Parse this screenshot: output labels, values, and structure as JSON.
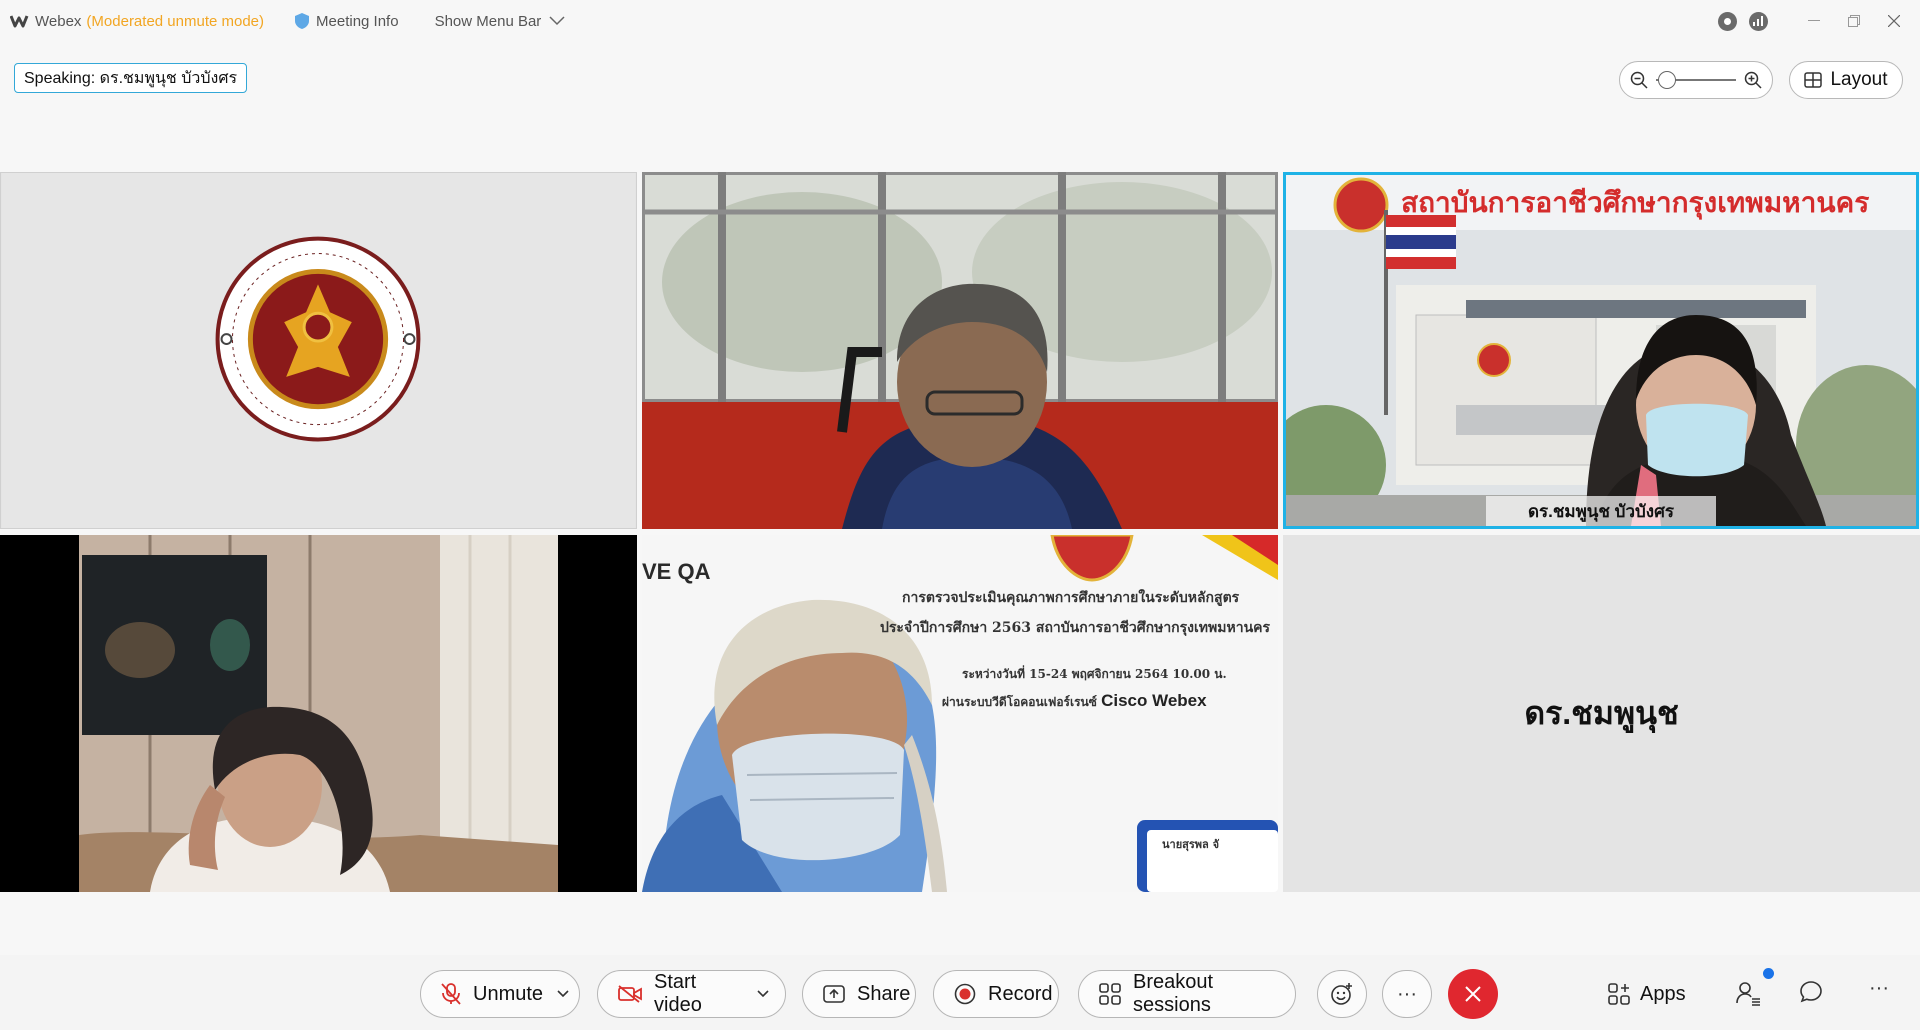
{
  "titlebar": {
    "app_name": "Webex",
    "mode": "(Moderated unmute mode)",
    "meeting_info": "Meeting Info",
    "show_menu_bar": "Show Menu Bar"
  },
  "speaking": {
    "label": "Speaking: ดร.ชมพูนุช บัวบังศร"
  },
  "view": {
    "layout_label": "Layout"
  },
  "tiles": {
    "t3_name": "ดร.ชมพูนุช บัวบังศร",
    "t3_banner": "สถาบันการอาชีวศึกษากรุงเทพมหานคร",
    "t5_qa": "VE QA",
    "t5_line1": "การตรวจประเมินคุณภาพการศึกษาภายในระดับหลักสูตร",
    "t5_line2": "ประจำปีการศึกษา 2563 สถาบันการอาชีวศึกษากรุงเทพมหานคร",
    "t5_line3": "ระหว่างวันที่ 15-24 พฤศจิกายน 2564 10.00 น.",
    "t5_line4": "ผ่านระบบวีดีโอคอนเฟอร์เรนซ์",
    "t5_line4_brand": "Cisco Webex",
    "t5_badge_name": "นายสุรพล จั",
    "t6_name": "ดร.ชมพูนุช"
  },
  "toolbar": {
    "unmute": "Unmute",
    "start_video": "Start video",
    "share": "Share",
    "record": "Record",
    "breakout": "Breakout sessions",
    "more": "···",
    "apps": "Apps",
    "overflow": "···"
  },
  "colors": {
    "accent_blue": "#1fb2e6",
    "mode_orange": "#f2a623",
    "leave_red": "#e0272f",
    "badge_blue": "#1a73e8"
  }
}
